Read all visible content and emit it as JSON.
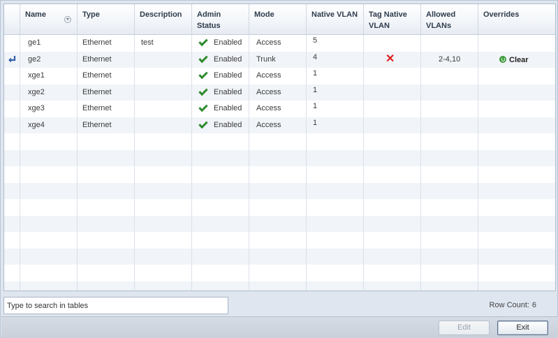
{
  "table": {
    "columns": [
      {
        "key": "name",
        "label": "Name"
      },
      {
        "key": "type",
        "label": "Type"
      },
      {
        "key": "description",
        "label": "Description"
      },
      {
        "key": "admin_status",
        "label": "Admin Status"
      },
      {
        "key": "mode",
        "label": "Mode"
      },
      {
        "key": "native_vlan",
        "label": "Native VLAN"
      },
      {
        "key": "tag_native_vlan",
        "label": "Tag Native VLAN"
      },
      {
        "key": "allowed_vlans",
        "label": "Allowed VLANs"
      },
      {
        "key": "overrides",
        "label": "Overrides"
      }
    ],
    "rows": [
      {
        "name": "ge1",
        "type": "Ethernet",
        "description": "test",
        "admin_status": "Enabled",
        "mode": "Access",
        "native_vlan": "5",
        "tag_native_vlan": "",
        "allowed_vlans": "",
        "overrides": "",
        "has_override_icon": false
      },
      {
        "name": "ge2",
        "type": "Ethernet",
        "description": "",
        "admin_status": "Enabled",
        "mode": "Trunk",
        "native_vlan": "4",
        "tag_native_vlan": "✕",
        "allowed_vlans": "2-4,10",
        "overrides": "Clear",
        "has_override_icon": true
      },
      {
        "name": "xge1",
        "type": "Ethernet",
        "description": "",
        "admin_status": "Enabled",
        "mode": "Access",
        "native_vlan": "1",
        "tag_native_vlan": "",
        "allowed_vlans": "",
        "overrides": "",
        "has_override_icon": false
      },
      {
        "name": "xge2",
        "type": "Ethernet",
        "description": "",
        "admin_status": "Enabled",
        "mode": "Access",
        "native_vlan": "1",
        "tag_native_vlan": "",
        "allowed_vlans": "",
        "overrides": "",
        "has_override_icon": false
      },
      {
        "name": "xge3",
        "type": "Ethernet",
        "description": "",
        "admin_status": "Enabled",
        "mode": "Access",
        "native_vlan": "1",
        "tag_native_vlan": "",
        "allowed_vlans": "",
        "overrides": "",
        "has_override_icon": false
      },
      {
        "name": "xge4",
        "type": "Ethernet",
        "description": "",
        "admin_status": "Enabled",
        "mode": "Access",
        "native_vlan": "1",
        "tag_native_vlan": "",
        "allowed_vlans": "",
        "overrides": "",
        "has_override_icon": false
      }
    ],
    "icons": {
      "sort": "sort-indicator-icon",
      "status": "checkmark-icon",
      "tag": "x-icon",
      "override": "override-arrow-icon",
      "clear": "refresh-icon"
    },
    "colors": {
      "check": "#2e8b2e",
      "x": "#e02020",
      "clear_icon": "#3b9a3b"
    }
  },
  "footer": {
    "search_placeholder": "Type to search in tables",
    "row_count_label": "Row Count:",
    "row_count": "6"
  },
  "actions": {
    "edit_label": "Edit",
    "exit_label": "Exit"
  }
}
